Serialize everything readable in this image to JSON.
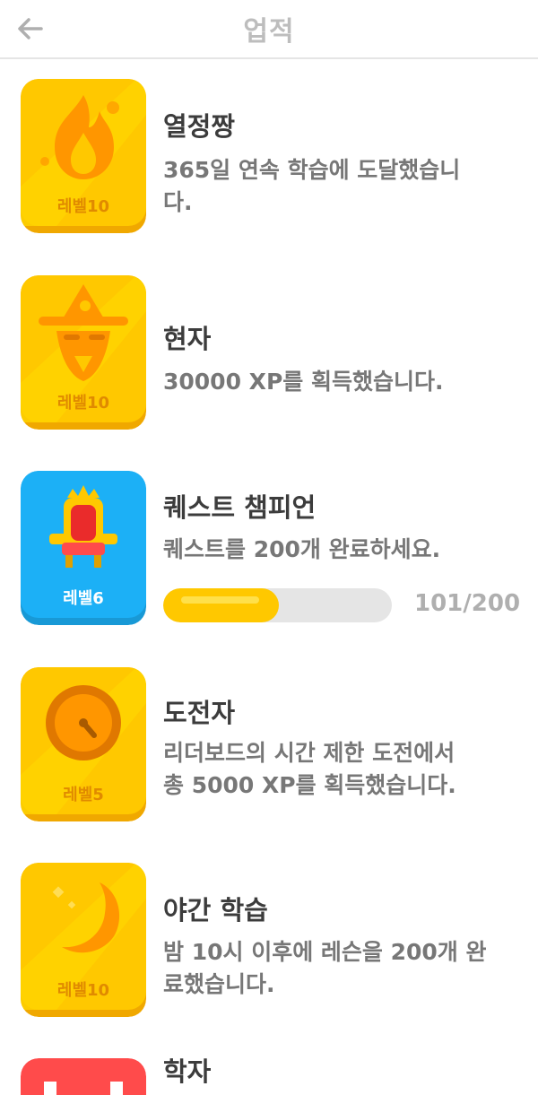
{
  "header": {
    "title": "업적"
  },
  "achievements": [
    {
      "name": "열정짱",
      "description": "365일 연속 학습에 도달했습니\n다.",
      "level": "레벨10",
      "badge_color": "gold",
      "icon": "flame-icon"
    },
    {
      "name": "현자",
      "description": "30000 XP를 획득했습니다.",
      "level": "레벨10",
      "badge_color": "gold",
      "icon": "wizard-icon"
    },
    {
      "name": "퀘스트 챔피언",
      "description": "퀘스트를 200개 완료하세요.",
      "level": "레벨6",
      "badge_color": "blue",
      "icon": "throne-icon",
      "progress": {
        "current": 101,
        "total": 200,
        "label": "101/200"
      }
    },
    {
      "name": "도전자",
      "description": "리더보드의 시간 제한 도전에서\n총 5000 XP를 획득했습니다.",
      "level": "레벨5",
      "badge_color": "gold",
      "icon": "stopwatch-icon"
    },
    {
      "name": "야간 학습",
      "description": "밤 10시 이후에 레슨을 200개 완\n료했습니다.",
      "level": "레벨10",
      "badge_color": "gold",
      "icon": "moon-icon"
    },
    {
      "name": "학자",
      "badge_color": "red",
      "icon": "scholar-icon"
    }
  ],
  "colors": {
    "gold": "#ffc800",
    "gold_light": "#ffdd00",
    "gold_shadow": "#f0a800",
    "blue": "#1cb0f6",
    "blue_shadow": "#1899d6",
    "red": "#ff4b4b",
    "progress_fill": "#ffc800",
    "progress_track": "#e5e5e5"
  }
}
